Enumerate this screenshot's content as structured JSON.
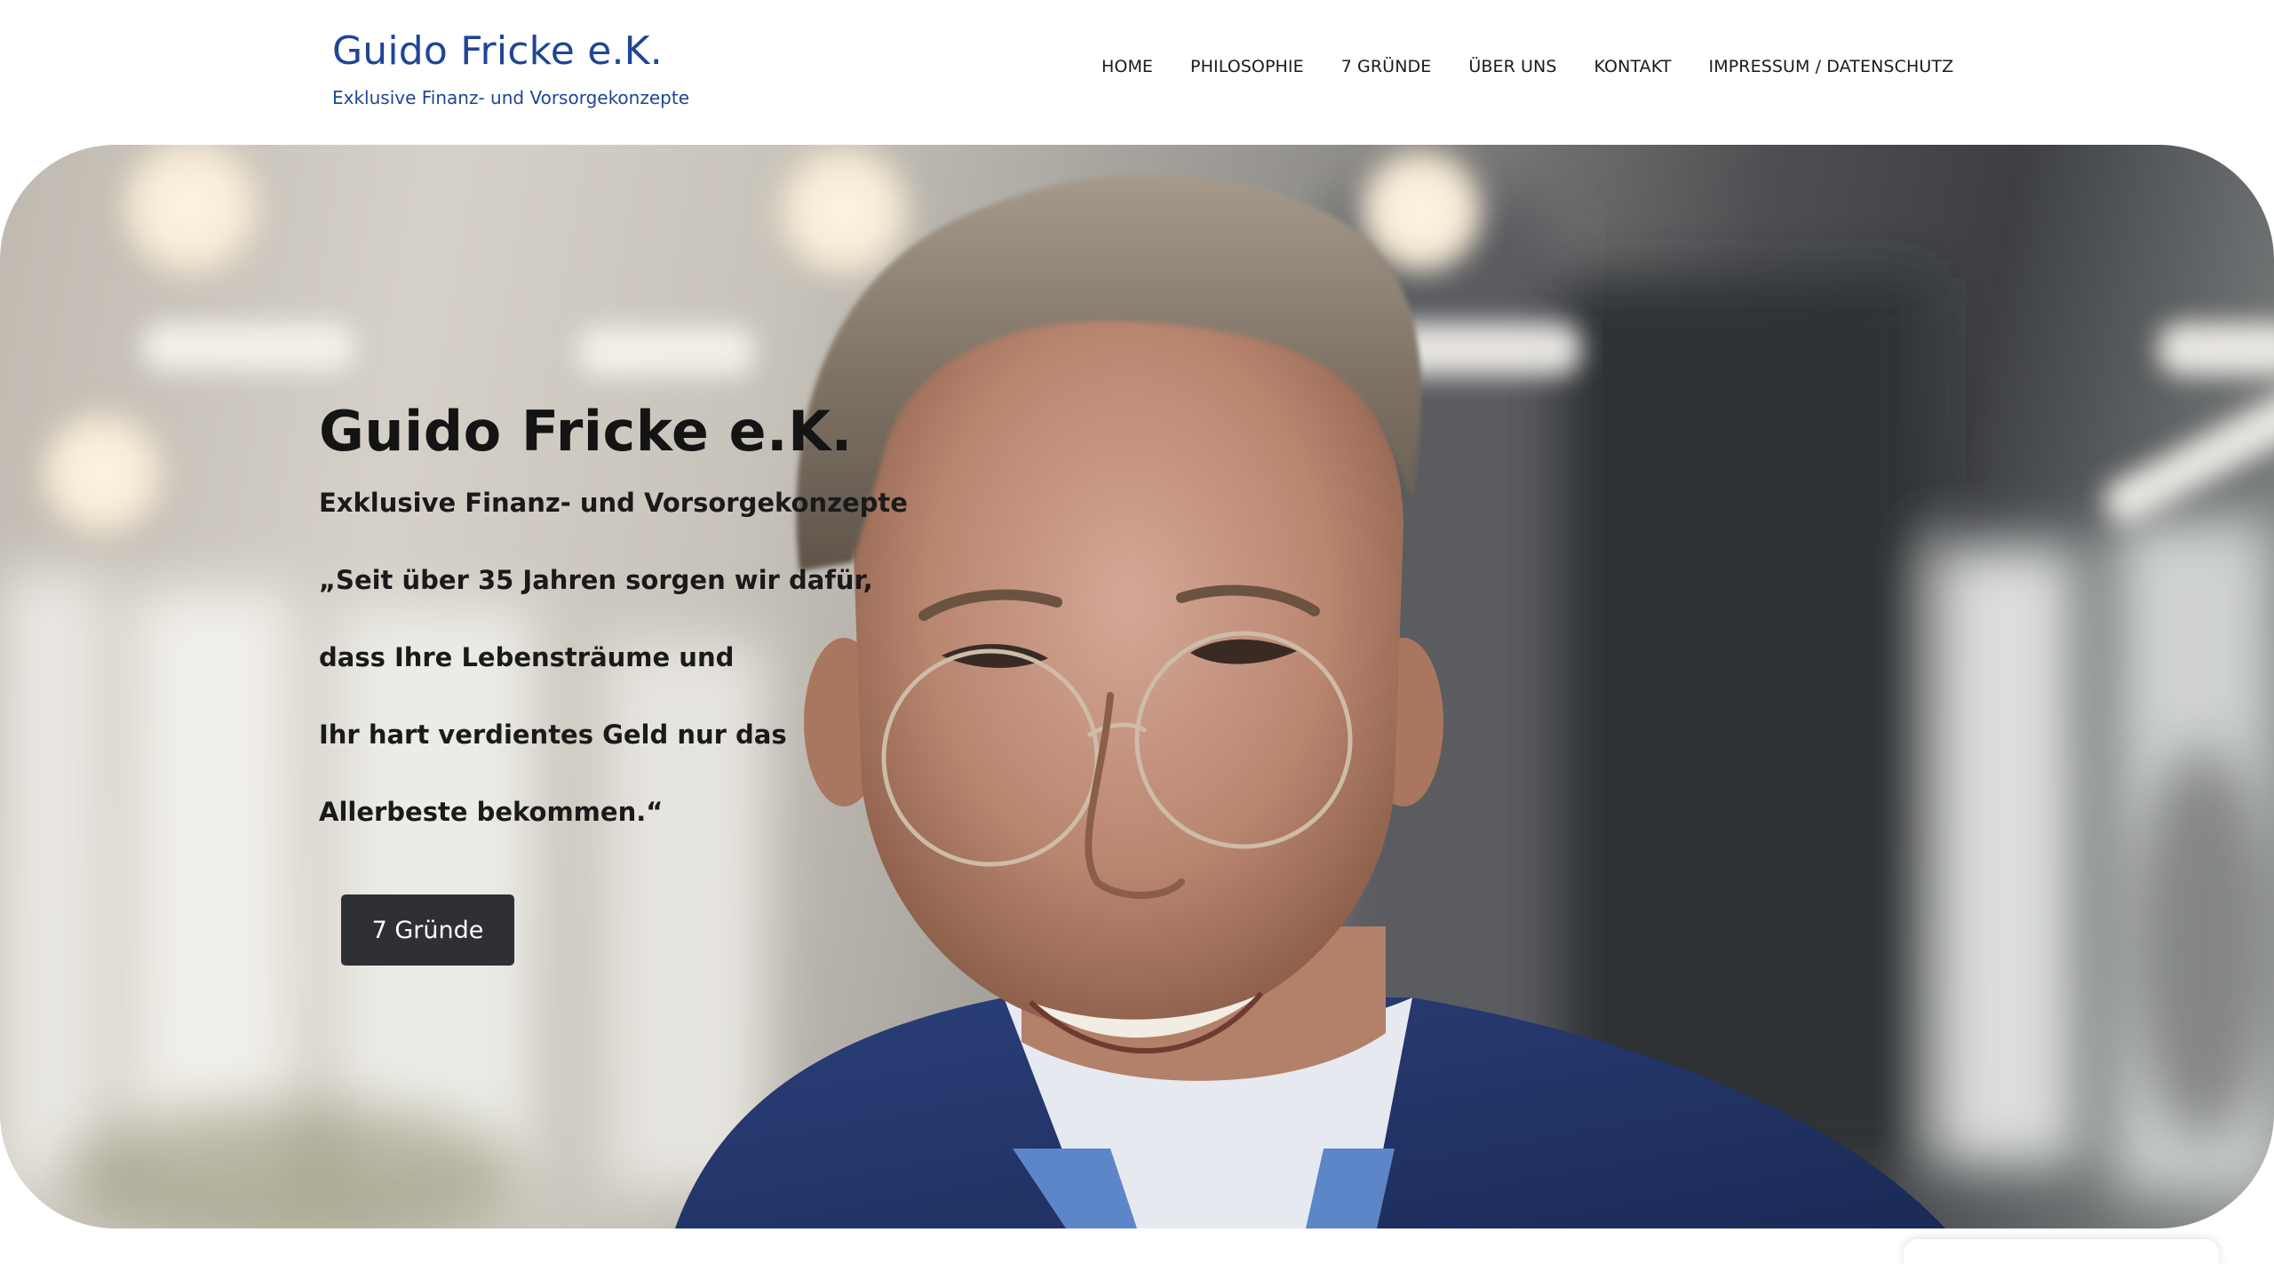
{
  "header": {
    "site_title": "Guido Fricke e.K.",
    "tagline": "Exklusive Finanz- und Vorsorgekonzepte",
    "nav": [
      {
        "label": "HOME"
      },
      {
        "label": "PHILOSOPHIE"
      },
      {
        "label": "7 GRÜNDE"
      },
      {
        "label": "ÜBER UNS"
      },
      {
        "label": "KONTAKT"
      },
      {
        "label": "IMPRESSUM / DATENSCHUTZ"
      }
    ]
  },
  "hero": {
    "title": "Guido Fricke e.K.",
    "subtitle": "Exklusive Finanz- und Vorsorgekonzepte",
    "quote_lines": [
      "„Seit über 35 Jahren sorgen wir dafür,",
      "dass Ihre Lebensträume und",
      "Ihr hart verdientes Geld nur das",
      "Allerbeste bekommen.“"
    ],
    "button_label": "7 Gründe"
  },
  "colors": {
    "brand_blue": "#1f4596",
    "button_bg": "#2e3034",
    "text_dark": "#141414"
  }
}
